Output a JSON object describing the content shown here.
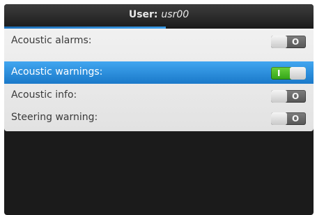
{
  "header": {
    "prefix": "User:",
    "username": "usr00"
  },
  "settings": [
    {
      "label": "Acoustic alarms:",
      "state": "off",
      "symbol": "O",
      "selected": false
    },
    {
      "label": "Acoustic warnings:",
      "state": "on",
      "symbol": "I",
      "selected": true
    },
    {
      "label": "Acoustic info:",
      "state": "off",
      "symbol": "O",
      "selected": false
    },
    {
      "label": "Steering warning:",
      "state": "off",
      "symbol": "O",
      "selected": false
    }
  ],
  "colors": {
    "selection": "#2a8ad8",
    "toggle_on": "#4bbb26",
    "toggle_off": "#6a6a6a",
    "title_accent": "#2b86d0"
  }
}
